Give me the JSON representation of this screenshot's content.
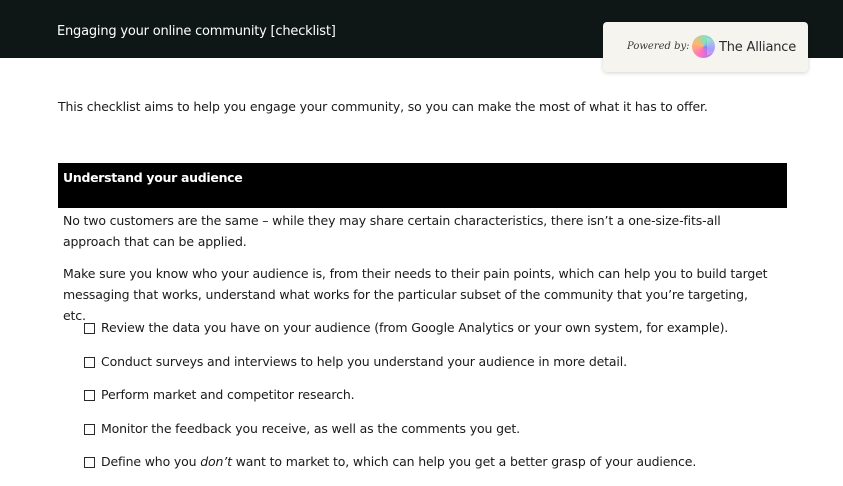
{
  "header": {
    "title": "Engaging your online community [checklist]",
    "powered_by": "Powered by:",
    "brand_name": "The Alliance",
    "brand_icon": "alliance-logo-icon",
    "background_color": "#0f1716"
  },
  "intro": "This checklist aims to help you engage your community, so you can make the most of what it has to offer.",
  "section": {
    "title": "Understand your audience",
    "paragraphs": [
      "No two customers are the same – while they may share certain characteristics, there isn’t a one-size-fits-all approach that can be applied.",
      "Make sure you know who your audience is, from their needs to their pain points, which can help you to build target messaging that works, understand what works for the particular subset of the community that you’re targeting, etc."
    ],
    "checklist": [
      {
        "text": "Review the data you have on your audience (from Google Analytics or your own system, for example).",
        "checked": false
      },
      {
        "text": "Conduct surveys and interviews to help you understand your audience in more detail.",
        "checked": false
      },
      {
        "text": "Perform market and competitor research.",
        "checked": false
      },
      {
        "text": "Monitor the feedback you receive, as well as the comments you get.",
        "checked": false
      },
      {
        "text_before": "Define who you ",
        "text_emphasis": "don’t",
        "text_after": " want to market to, which can help you get a better grasp of your audience.",
        "checked": false
      }
    ]
  }
}
